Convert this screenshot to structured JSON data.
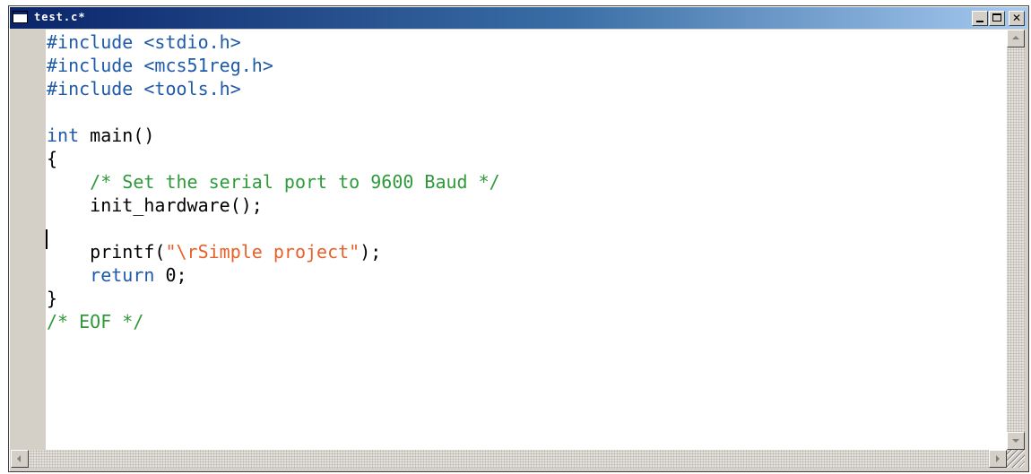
{
  "window": {
    "title": "test.c*",
    "buttons": {
      "minimize": "minimize",
      "maximize": "maximize",
      "close": "close"
    }
  },
  "colors": {
    "keyword": "#1e5aa8",
    "comment": "#2e9a3a",
    "string": "#e8602a",
    "plain": "#000000",
    "gutter": "#d4d0c8"
  },
  "editor": {
    "lines": [
      [
        {
          "t": "#include <stdio.h>",
          "c": "keyword"
        }
      ],
      [
        {
          "t": "#include <mcs51reg.h>",
          "c": "keyword"
        }
      ],
      [
        {
          "t": "#include <tools.h>",
          "c": "keyword"
        }
      ],
      [],
      [
        {
          "t": "int",
          "c": "keyword"
        },
        {
          "t": " main()",
          "c": "plain"
        }
      ],
      [
        {
          "t": "{",
          "c": "plain"
        }
      ],
      [
        {
          "t": "    /* Set the serial port to 9600 Baud */",
          "c": "comment"
        }
      ],
      [
        {
          "t": "    init_hardware();",
          "c": "plain"
        }
      ],
      [],
      [
        {
          "t": "    printf(",
          "c": "plain"
        },
        {
          "t": "\"\\rSimple project\"",
          "c": "string"
        },
        {
          "t": ");",
          "c": "plain"
        }
      ],
      [
        {
          "t": "    ",
          "c": "plain"
        },
        {
          "t": "return",
          "c": "keyword"
        },
        {
          "t": " 0;",
          "c": "plain"
        }
      ],
      [
        {
          "t": "}",
          "c": "plain"
        }
      ],
      [
        {
          "t": "/* EOF */",
          "c": "comment"
        }
      ]
    ]
  }
}
